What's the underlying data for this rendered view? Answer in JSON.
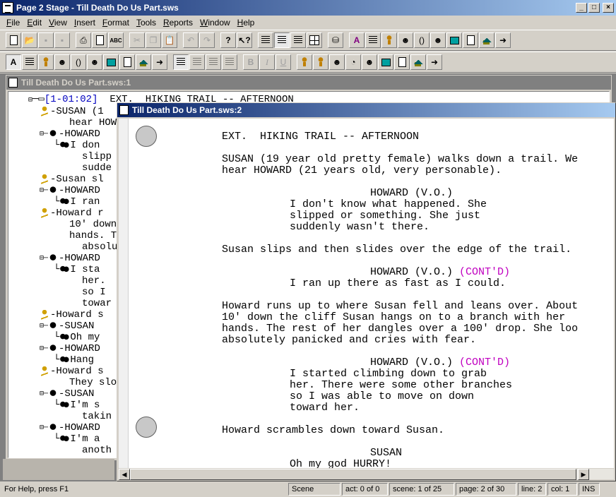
{
  "app": {
    "title": "Page 2 Stage - Till Death Do Us Part.sws"
  },
  "menu": [
    "File",
    "Edit",
    "View",
    "Insert",
    "Format",
    "Tools",
    "Reports",
    "Window",
    "Help"
  ],
  "toolbar1": {
    "icons": [
      "new-icon",
      "open-icon",
      "save-icon",
      "save-all-icon",
      "print-icon",
      "print-preview-icon",
      "spellcheck-icon",
      "cut-icon",
      "copy-icon",
      "paste-icon",
      "undo-icon",
      "redo-icon",
      "help-icon",
      "context-help-icon",
      "align-left-icon",
      "align-center-icon",
      "align-right-icon",
      "grid-view-icon",
      "find-icon",
      "format-a-icon",
      "format-line-icon",
      "action-icon",
      "character-icon",
      "transition-icon",
      "dialogue-icon",
      "note-icon",
      "page-icon",
      "scene-icon",
      "forward-icon"
    ]
  },
  "toolbar2": {
    "icons": [
      "style-a-icon",
      "style-line-icon",
      "style-action-icon",
      "style-character-icon",
      "style-paren-icon",
      "style-dialogue-icon",
      "style-box-icon",
      "style-page-icon",
      "style-house-icon",
      "style-forward-icon",
      "view1-icon",
      "view2-icon",
      "view3-icon",
      "view4-icon",
      "bold-icon",
      "italic-icon",
      "underline-icon",
      "nav1-icon",
      "nav2-icon",
      "nav3-icon",
      "nav4-icon",
      "nav5-icon",
      "nav6-icon",
      "nav7-icon",
      "nav8-icon",
      "nav9-icon"
    ],
    "bold": "B",
    "italic": "I",
    "underline": "U",
    "paren": "()",
    "a_glyph": "A"
  },
  "window1": {
    "title": "Till Death Do Us Part.sws:1",
    "scene_id": "[1-01:02]",
    "scene_heading": "EXT.  HIKING TRAIL -- AFTERNOON",
    "tree": [
      {
        "type": "action",
        "text": "-SUSAN (1"
      },
      {
        "type": "text",
        "text": "hear HOW"
      },
      {
        "type": "char",
        "text": "-HOWARD "
      },
      {
        "type": "dia",
        "text": "I don"
      },
      {
        "type": "text",
        "text": "slipp"
      },
      {
        "type": "text",
        "text": "sudde"
      },
      {
        "type": "action",
        "text": "-Susan sl"
      },
      {
        "type": "char",
        "text": "-HOWARD "
      },
      {
        "type": "dia",
        "text": "I ran"
      },
      {
        "type": "action",
        "text": "-Howard r"
      },
      {
        "type": "text",
        "text": "10' down"
      },
      {
        "type": "text",
        "text": "hands. T"
      },
      {
        "type": "text",
        "text": "absolute"
      },
      {
        "type": "char",
        "text": "-HOWARD "
      },
      {
        "type": "dia",
        "text": "I sta"
      },
      {
        "type": "text",
        "text": "her. "
      },
      {
        "type": "text",
        "text": "so I "
      },
      {
        "type": "text",
        "text": "towar"
      },
      {
        "type": "action",
        "text": "-Howard s"
      },
      {
        "type": "char",
        "text": "-SUSAN"
      },
      {
        "type": "dia",
        "text": "Oh my"
      },
      {
        "type": "char",
        "text": "-HOWARD "
      },
      {
        "type": "dia",
        "text": "Hang"
      },
      {
        "type": "action",
        "text": "-Howard s"
      },
      {
        "type": "text",
        "text": "They slo"
      },
      {
        "type": "char",
        "text": "-SUSAN"
      },
      {
        "type": "dia",
        "text": "I'm s"
      },
      {
        "type": "text",
        "text": "takin"
      },
      {
        "type": "char",
        "text": "-HOWARD "
      },
      {
        "type": "dia",
        "text": "I'm a"
      },
      {
        "type": "text",
        "text": "anoth"
      }
    ]
  },
  "window2": {
    "title": "Till Death Do Us Part.sws:2",
    "lines": [
      {
        "text": "EXT.  HIKING TRAIL -- AFTERNOON",
        "indent": "heading"
      },
      {
        "text": "SUSAN (19 year old pretty female) walks down a trail. We",
        "indent": "action"
      },
      {
        "text": "hear HOWARD (21 years old, very personable).",
        "indent": "action"
      },
      {
        "text": "HOWARD (V.O.)",
        "indent": "char"
      },
      {
        "text": "I don't know what happened. She",
        "indent": "dia"
      },
      {
        "text": "slipped or something. She just",
        "indent": "dia"
      },
      {
        "text": "suddenly wasn't there.",
        "indent": "dia"
      },
      {
        "text": "Susan slips and then slides over the edge of the trail.",
        "indent": "action"
      },
      {
        "text": "HOWARD (V.O.)",
        "indent": "char",
        "contd": "(CONT'D)"
      },
      {
        "text": "I ran up there as fast as I could.",
        "indent": "dia"
      },
      {
        "text": "Howard runs up to where Susan fell and leans over. About",
        "indent": "action"
      },
      {
        "text": "10' down the cliff Susan hangs on to a branch with her",
        "indent": "action"
      },
      {
        "text": "hands. The rest of her dangles over a 100' drop. She loo",
        "indent": "action"
      },
      {
        "text": "absolutely panicked and cries with fear.",
        "indent": "action"
      },
      {
        "text": "HOWARD (V.O.)",
        "indent": "char",
        "contd": "(CONT'D)"
      },
      {
        "text": "I started climbing down to grab",
        "indent": "dia"
      },
      {
        "text": "her. There were some other branches",
        "indent": "dia"
      },
      {
        "text": "so I was able to move on down",
        "indent": "dia"
      },
      {
        "text": "toward her.",
        "indent": "dia"
      },
      {
        "text": "Howard scrambles down toward Susan.",
        "indent": "action"
      },
      {
        "text": "SUSAN",
        "indent": "char"
      },
      {
        "text": "Oh my god HURRY!",
        "indent": "dia"
      }
    ]
  },
  "status": {
    "help": "For Help, press F1",
    "type": "Scene",
    "act": "act: 0 of 0",
    "scene": "scene: 1 of 25",
    "page": "page: 2 of 30",
    "line": "line: 2",
    "col": "col: 1",
    "mode": "INS"
  },
  "colors": {
    "active_title_start": "#0a246a",
    "active_title_end": "#a6caf0",
    "contd": "#c000c0",
    "scene_link": "#0000c0"
  }
}
